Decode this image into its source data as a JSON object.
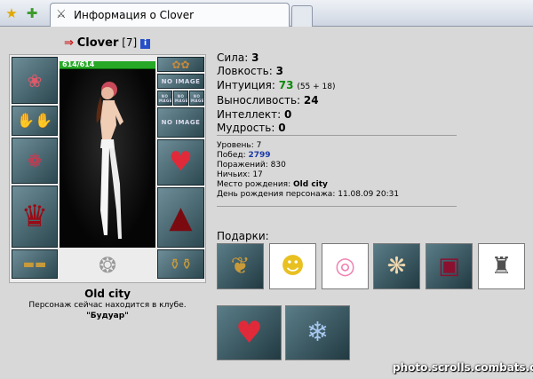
{
  "browser": {
    "tab_title": "Информация о Clover"
  },
  "character": {
    "name": "Clover",
    "level": "[7]",
    "info_icon": "i",
    "hp": "614/614",
    "hp_fraction": 1.0,
    "city": "Old city",
    "location_line1": "Персонаж сейчас находится в клубе.",
    "location_line2": "\"Будуар\""
  },
  "stats": [
    {
      "label": "Сила:",
      "value": "3",
      "extra": ""
    },
    {
      "label": "Ловкость:",
      "value": "3",
      "extra": ""
    },
    {
      "label": "Интуиция:",
      "value": "73",
      "extra": "(55 + 18)"
    },
    {
      "label": "Выносливость:",
      "value": "24",
      "extra": ""
    },
    {
      "label": "Интеллект:",
      "value": "0",
      "extra": ""
    },
    {
      "label": "Мудрость:",
      "value": "0",
      "extra": ""
    }
  ],
  "info": {
    "level_label": "Уровень:",
    "level_value": "7",
    "wins_label": "Побед:",
    "wins_value": "2799",
    "losses_label": "Поражений:",
    "losses_value": "830",
    "draws_label": "Ничьих:",
    "draws_value": "17",
    "birthplace_label": "Место рождения:",
    "birthplace_value": "Old city",
    "birthday_label": "День рождения персонажа:",
    "birthday_value": "11.08.09 20:31"
  },
  "slots": {
    "no_image": "NO IMAGE"
  },
  "gifts": {
    "label": "Подарки:"
  },
  "watermark": "photo.scrolls.combats.com",
  "colors": {
    "hp_green": "#27a927",
    "intuition_green": "#0a8a0a",
    "wins_blue": "#1a3aa6",
    "slot_teal": "#4e6f79"
  }
}
